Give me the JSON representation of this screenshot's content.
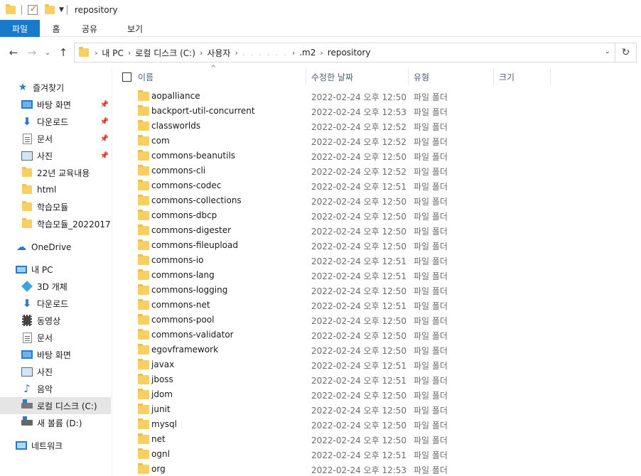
{
  "window": {
    "title": "repository"
  },
  "ribbon": {
    "tabs": [
      {
        "label": "파일"
      },
      {
        "label": "홈"
      },
      {
        "label": "공유"
      },
      {
        "label": "보기"
      }
    ]
  },
  "address": {
    "crumbs": [
      "내 PC",
      "로컬 디스크 (C:)",
      "사용자",
      ". . . . . .",
      ".m2",
      "repository"
    ]
  },
  "sidebar": {
    "items": [
      {
        "label": "즐겨찾기",
        "icon": "star-icon"
      },
      {
        "label": "바탕 화면",
        "icon": "desktop-icon",
        "pinned": true
      },
      {
        "label": "다운로드",
        "icon": "download-icon",
        "pinned": true
      },
      {
        "label": "문서",
        "icon": "document-icon",
        "pinned": true
      },
      {
        "label": "사진",
        "icon": "pictures-icon",
        "pinned": true
      },
      {
        "label": "22년 교육내용",
        "icon": "folder-icon"
      },
      {
        "label": "html",
        "icon": "folder-icon"
      },
      {
        "label": "학습모듈",
        "icon": "folder-icon"
      },
      {
        "label": "학습모듈_2022017",
        "icon": "folder-icon"
      },
      {
        "label": "OneDrive",
        "icon": "onedrive-icon"
      },
      {
        "label": "내 PC",
        "icon": "pc-icon"
      },
      {
        "label": "3D 개체",
        "icon": "3d-objects-icon"
      },
      {
        "label": "다운로드",
        "icon": "download-icon"
      },
      {
        "label": "동영상",
        "icon": "video-icon"
      },
      {
        "label": "문서",
        "icon": "document-icon"
      },
      {
        "label": "바탕 화면",
        "icon": "desktop-icon"
      },
      {
        "label": "사진",
        "icon": "pictures-icon"
      },
      {
        "label": "음악",
        "icon": "music-icon"
      },
      {
        "label": "로컬 디스크 (C:)",
        "icon": "drive-c-icon",
        "selected": true
      },
      {
        "label": "새 볼륨 (D:)",
        "icon": "drive-d-icon"
      },
      {
        "label": "네트워크",
        "icon": "network-icon"
      }
    ]
  },
  "columns": {
    "name": "이름",
    "modified": "수정한 날짜",
    "type": "유형",
    "size": "크기"
  },
  "files": [
    {
      "name": "aopalliance",
      "modified": "2022-02-24 오후 12:50",
      "type": "파일 폴더"
    },
    {
      "name": "backport-util-concurrent",
      "modified": "2022-02-24 오후 12:53",
      "type": "파일 폴더"
    },
    {
      "name": "classworlds",
      "modified": "2022-02-24 오후 12:52",
      "type": "파일 폴더"
    },
    {
      "name": "com",
      "modified": "2022-02-24 오후 12:52",
      "type": "파일 폴더"
    },
    {
      "name": "commons-beanutils",
      "modified": "2022-02-24 오후 12:50",
      "type": "파일 폴더"
    },
    {
      "name": "commons-cli",
      "modified": "2022-02-24 오후 12:52",
      "type": "파일 폴더"
    },
    {
      "name": "commons-codec",
      "modified": "2022-02-24 오후 12:51",
      "type": "파일 폴더"
    },
    {
      "name": "commons-collections",
      "modified": "2022-02-24 오후 12:50",
      "type": "파일 폴더"
    },
    {
      "name": "commons-dbcp",
      "modified": "2022-02-24 오후 12:50",
      "type": "파일 폴더"
    },
    {
      "name": "commons-digester",
      "modified": "2022-02-24 오후 12:50",
      "type": "파일 폴더"
    },
    {
      "name": "commons-fileupload",
      "modified": "2022-02-24 오후 12:50",
      "type": "파일 폴더"
    },
    {
      "name": "commons-io",
      "modified": "2022-02-24 오후 12:51",
      "type": "파일 폴더"
    },
    {
      "name": "commons-lang",
      "modified": "2022-02-24 오후 12:51",
      "type": "파일 폴더"
    },
    {
      "name": "commons-logging",
      "modified": "2022-02-24 오후 12:50",
      "type": "파일 폴더"
    },
    {
      "name": "commons-net",
      "modified": "2022-02-24 오후 12:51",
      "type": "파일 폴더"
    },
    {
      "name": "commons-pool",
      "modified": "2022-02-24 오후 12:50",
      "type": "파일 폴더"
    },
    {
      "name": "commons-validator",
      "modified": "2022-02-24 오후 12:50",
      "type": "파일 폴더"
    },
    {
      "name": "egovframework",
      "modified": "2022-02-24 오후 12:50",
      "type": "파일 폴더"
    },
    {
      "name": "javax",
      "modified": "2022-02-24 오후 12:51",
      "type": "파일 폴더"
    },
    {
      "name": "jboss",
      "modified": "2022-02-24 오후 12:51",
      "type": "파일 폴더"
    },
    {
      "name": "jdom",
      "modified": "2022-02-24 오후 12:50",
      "type": "파일 폴더"
    },
    {
      "name": "junit",
      "modified": "2022-02-24 오후 12:50",
      "type": "파일 폴더"
    },
    {
      "name": "mysql",
      "modified": "2022-02-24 오후 12:50",
      "type": "파일 폴더"
    },
    {
      "name": "net",
      "modified": "2022-02-24 오후 12:50",
      "type": "파일 폴더"
    },
    {
      "name": "ognl",
      "modified": "2022-02-24 오후 12:51",
      "type": "파일 폴더"
    },
    {
      "name": "org",
      "modified": "2022-02-24 오후 12:53",
      "type": "파일 폴더"
    }
  ]
}
